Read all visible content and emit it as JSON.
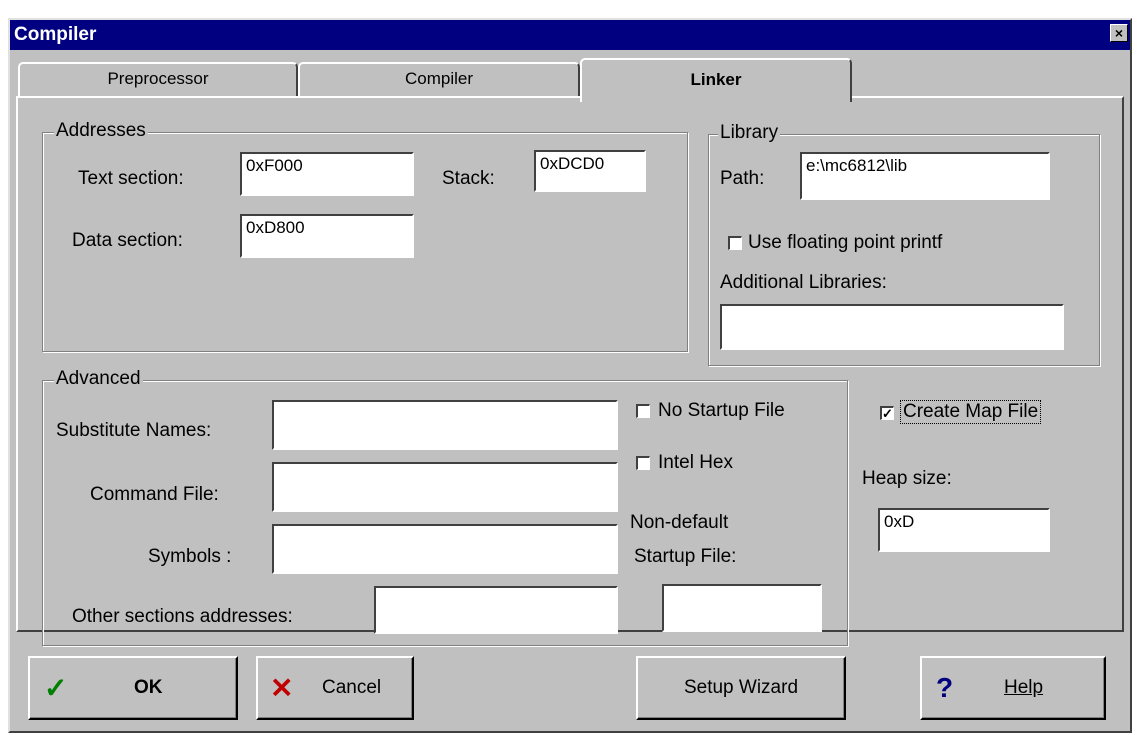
{
  "window": {
    "title": "Compiler",
    "close_glyph": "×"
  },
  "tabs": [
    {
      "label": "Preprocessor"
    },
    {
      "label": "Compiler"
    },
    {
      "label": "Linker",
      "active": true
    }
  ],
  "addresses": {
    "legend": "Addresses",
    "text_section_label": "Text section:",
    "text_section_value": "0xF000",
    "stack_label": "Stack:",
    "stack_value": "0xDCD0",
    "data_section_label": "Data section:",
    "data_section_value": "0xD800"
  },
  "library": {
    "legend": "Library",
    "path_label": "Path:",
    "path_value": "e:\\mc6812\\lib",
    "float_printf_label": "Use floating point printf",
    "float_printf_checked": false,
    "additional_label": "Additional Libraries:",
    "additional_value": ""
  },
  "advanced": {
    "legend": "Advanced",
    "substitute_label": "Substitute Names:",
    "substitute_value": "",
    "command_label": "Command File:",
    "command_value": "",
    "symbols_label": "Symbols :",
    "symbols_value": "",
    "other_label": "Other sections addresses:",
    "other_value": "",
    "no_startup_label": "No Startup File",
    "no_startup_checked": false,
    "intel_hex_label": "Intel Hex",
    "intel_hex_checked": false,
    "nondefault_line1": "Non-default",
    "nondefault_line2": "Startup File:",
    "nondefault_value": ""
  },
  "map": {
    "create_map_label": "Create Map File",
    "create_map_checked": true,
    "heap_label": "Heap size:",
    "heap_value": "0xD"
  },
  "buttons": {
    "ok": "OK",
    "cancel": "Cancel",
    "wizard": "Setup Wizard",
    "help": "Help"
  },
  "colors": {
    "titlebar": "#000080",
    "ok_icon": "#008000",
    "cancel_icon": "#c00000",
    "help_icon": "#000080",
    "face": "#c0c0c0"
  },
  "icons": {
    "ok": "checkmark-icon",
    "cancel": "x-icon",
    "help": "question-icon"
  }
}
